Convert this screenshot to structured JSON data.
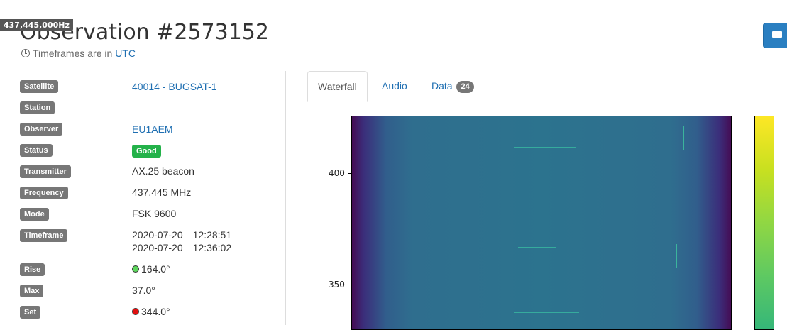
{
  "tooltip": {
    "frequency": "437,445,000Hz"
  },
  "header": {
    "title": "Observation #2573152",
    "timezone_prefix": "Timeframes are in",
    "timezone_link": "UTC"
  },
  "details": {
    "satellite": {
      "label": "Satellite",
      "value": "40014 - BUGSAT-1"
    },
    "station": {
      "label": "Station",
      "value": ""
    },
    "observer": {
      "label": "Observer",
      "value": "EU1AEM"
    },
    "status": {
      "label": "Status",
      "value": "Good"
    },
    "transmitter": {
      "label": "Transmitter",
      "value": "AX.25 beacon"
    },
    "frequency": {
      "label": "Frequency",
      "value": "437.445 MHz"
    },
    "mode": {
      "label": "Mode",
      "value": "FSK 9600"
    },
    "timeframe": {
      "label": "Timeframe",
      "start_date": "2020-07-20",
      "start_time": "12:28:51",
      "end_date": "2020-07-20",
      "end_time": "12:36:02"
    },
    "rise": {
      "label": "Rise",
      "value": "164.0°"
    },
    "max": {
      "label": "Max",
      "value": "37.0°"
    },
    "set": {
      "label": "Set",
      "value": "344.0°"
    }
  },
  "tabs": [
    {
      "label": "Waterfall",
      "active": true
    },
    {
      "label": "Audio",
      "active": false
    },
    {
      "label": "Data",
      "count": "24",
      "active": false
    }
  ],
  "waterfall": {
    "y_ticks": [
      "400",
      "350"
    ],
    "colormap": "viridis"
  },
  "colors": {
    "accent": "#1f6fb2",
    "good": "#24b24a",
    "label_bg": "#777777",
    "rise_dot": "#5cd65c",
    "set_dot": "#e01010"
  }
}
